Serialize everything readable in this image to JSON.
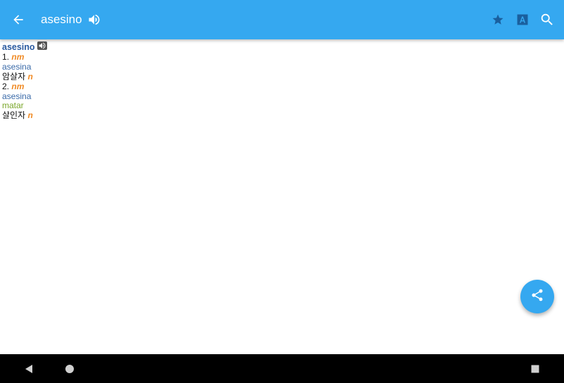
{
  "appbar": {
    "title": "asesino",
    "icons": [
      "back-arrow-icon",
      "speaker-icon",
      "star-icon",
      "translate-icon",
      "search-icon"
    ]
  },
  "entry": {
    "headword": "asesino",
    "senses": [
      {
        "number": "1.",
        "pos": "nm",
        "refs": [
          {
            "text": "asesina",
            "kind": "word"
          }
        ],
        "translation": "암살자",
        "translation_pos": "n"
      },
      {
        "number": "2.",
        "pos": "nm",
        "refs": [
          {
            "text": "asesina",
            "kind": "word"
          },
          {
            "text": "matar",
            "kind": "verb"
          }
        ],
        "translation": "살인자",
        "translation_pos": "n"
      }
    ]
  },
  "fab": {
    "icon": "share-icon"
  },
  "navbar": {
    "icons": [
      "back-triangle-icon",
      "home-circle-icon",
      "recents-square-icon"
    ]
  },
  "colors": {
    "appbar": "#35a8f0",
    "headword": "#2a5aa0",
    "pos": "#f08a24",
    "ref_word": "#3a6aa8",
    "ref_verb": "#7aa62a"
  }
}
